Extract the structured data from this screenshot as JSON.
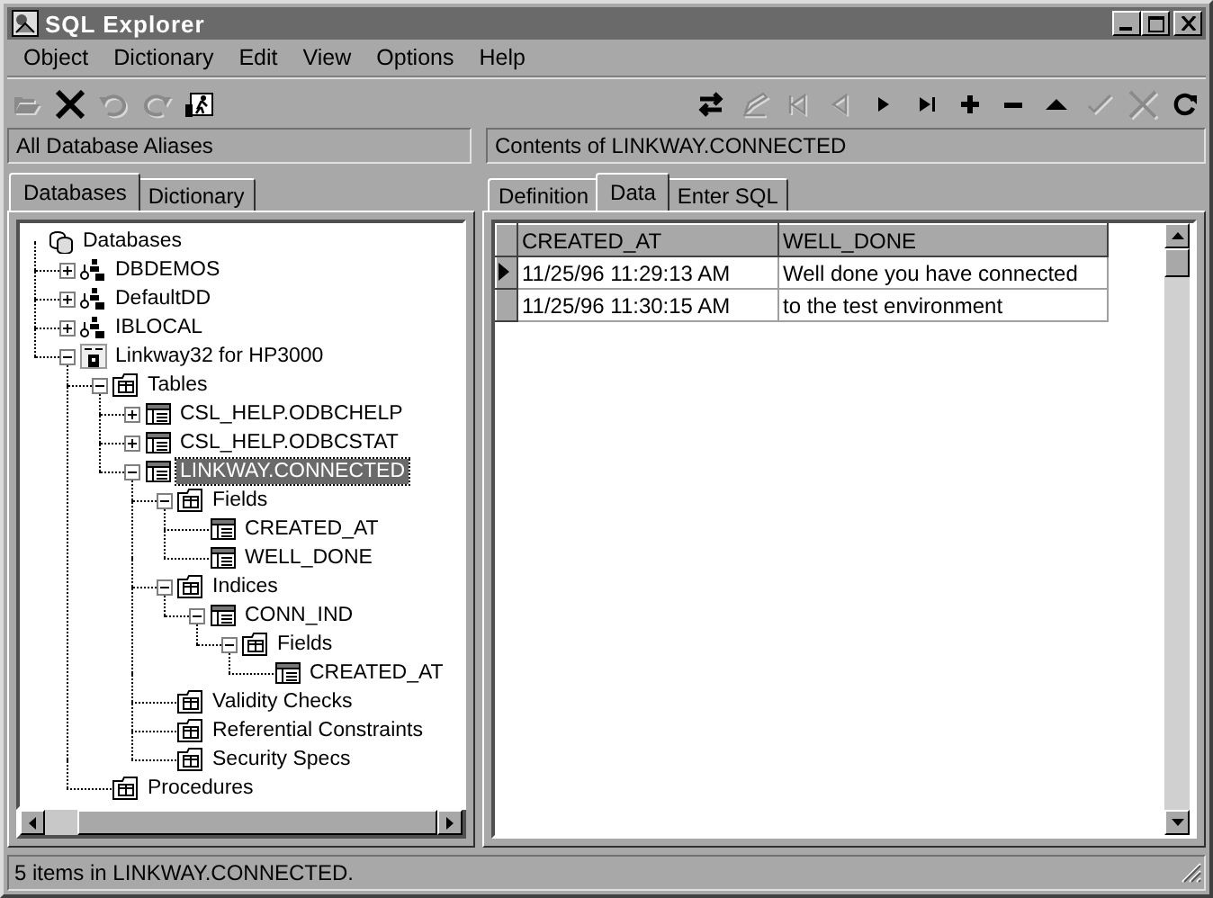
{
  "window": {
    "title": "SQL Explorer"
  },
  "menu": [
    {
      "label": "Object"
    },
    {
      "label": "Dictionary"
    },
    {
      "label": "Edit"
    },
    {
      "label": "View"
    },
    {
      "label": "Options"
    },
    {
      "label": "Help"
    }
  ],
  "toolbar_left": [
    {
      "kind": "open",
      "disabled": true
    },
    {
      "kind": "delete",
      "disabled": false
    },
    {
      "kind": "undo",
      "disabled": true
    },
    {
      "kind": "redo",
      "disabled": true
    },
    {
      "kind": "run",
      "disabled": false
    }
  ],
  "toolbar_right": [
    {
      "kind": "swap",
      "disabled": false
    },
    {
      "kind": "edit",
      "disabled": true
    },
    {
      "kind": "first",
      "disabled": true
    },
    {
      "kind": "prior",
      "disabled": true
    },
    {
      "kind": "next",
      "disabled": false
    },
    {
      "kind": "last",
      "disabled": false
    },
    {
      "kind": "insert",
      "disabled": false
    },
    {
      "kind": "remove",
      "disabled": false
    },
    {
      "kind": "up",
      "disabled": false
    },
    {
      "kind": "post",
      "disabled": true
    },
    {
      "kind": "cancel",
      "disabled": true
    },
    {
      "kind": "refresh",
      "disabled": false
    }
  ],
  "left_header": "All Database Aliases",
  "right_header": "Contents of LINKWAY.CONNECTED",
  "left_tabs": [
    {
      "label": "Databases",
      "selected": true
    },
    {
      "label": "Dictionary",
      "selected": false
    }
  ],
  "tree": [
    {
      "label": "Databases",
      "kind": "databases",
      "selected": false,
      "children": [
        {
          "label": "DBDEMOS",
          "kind": "alias",
          "selected": false,
          "expanded": false
        },
        {
          "label": "DefaultDD",
          "kind": "alias",
          "selected": false,
          "expanded": false
        },
        {
          "label": "IBLOCAL",
          "kind": "alias",
          "selected": false,
          "expanded": false
        },
        {
          "label": "Linkway32 for HP3000",
          "kind": "server",
          "selected": false,
          "expanded": true,
          "children": [
            {
              "label": "Tables",
              "kind": "folder",
              "selected": false,
              "expanded": true,
              "children": [
                {
                  "label": "CSL_HELP.ODBCHELP",
                  "kind": "table",
                  "selected": false,
                  "expanded": false
                },
                {
                  "label": "CSL_HELP.ODBCSTAT",
                  "kind": "table",
                  "selected": false,
                  "expanded": false
                },
                {
                  "label": "LINKWAY.CONNECTED",
                  "kind": "table",
                  "selected": true,
                  "expanded": true,
                  "children": [
                    {
                      "label": "Fields",
                      "kind": "folder",
                      "selected": false,
                      "expanded": true,
                      "children": [
                        {
                          "label": "CREATED_AT",
                          "kind": "table",
                          "selected": false
                        },
                        {
                          "label": "WELL_DONE",
                          "kind": "table",
                          "selected": false
                        }
                      ]
                    },
                    {
                      "label": "Indices",
                      "kind": "folder",
                      "selected": false,
                      "expanded": true,
                      "children": [
                        {
                          "label": "CONN_IND",
                          "kind": "table",
                          "selected": false,
                          "expanded": true,
                          "children": [
                            {
                              "label": "Fields",
                              "kind": "folder",
                              "selected": false,
                              "expanded": true,
                              "children": [
                                {
                                  "label": "CREATED_AT",
                                  "kind": "table",
                                  "selected": false
                                }
                              ]
                            }
                          ]
                        }
                      ]
                    },
                    {
                      "label": "Validity Checks",
                      "kind": "folder",
                      "selected": false
                    },
                    {
                      "label": "Referential Constraints",
                      "kind": "folder",
                      "selected": false
                    },
                    {
                      "label": "Security Specs",
                      "kind": "folder",
                      "selected": false
                    }
                  ]
                }
              ]
            },
            {
              "label": "Procedures",
              "kind": "folder",
              "selected": false
            }
          ]
        }
      ]
    }
  ],
  "right_tabs": [
    {
      "label": "Definition",
      "selected": false
    },
    {
      "label": "Data",
      "selected": true
    },
    {
      "label": "Enter SQL",
      "selected": false
    }
  ],
  "grid": {
    "columns": [
      "CREATED_AT",
      "WELL_DONE"
    ],
    "rows": [
      {
        "cells": [
          "11/25/96 11:29:13 AM",
          "Well done you have connected"
        ],
        "selected": true
      },
      {
        "cells": [
          "11/25/96 11:30:15 AM",
          "to the test environment"
        ],
        "selected": false
      }
    ]
  },
  "status_bar": "5 items in LINKWAY.CONNECTED."
}
